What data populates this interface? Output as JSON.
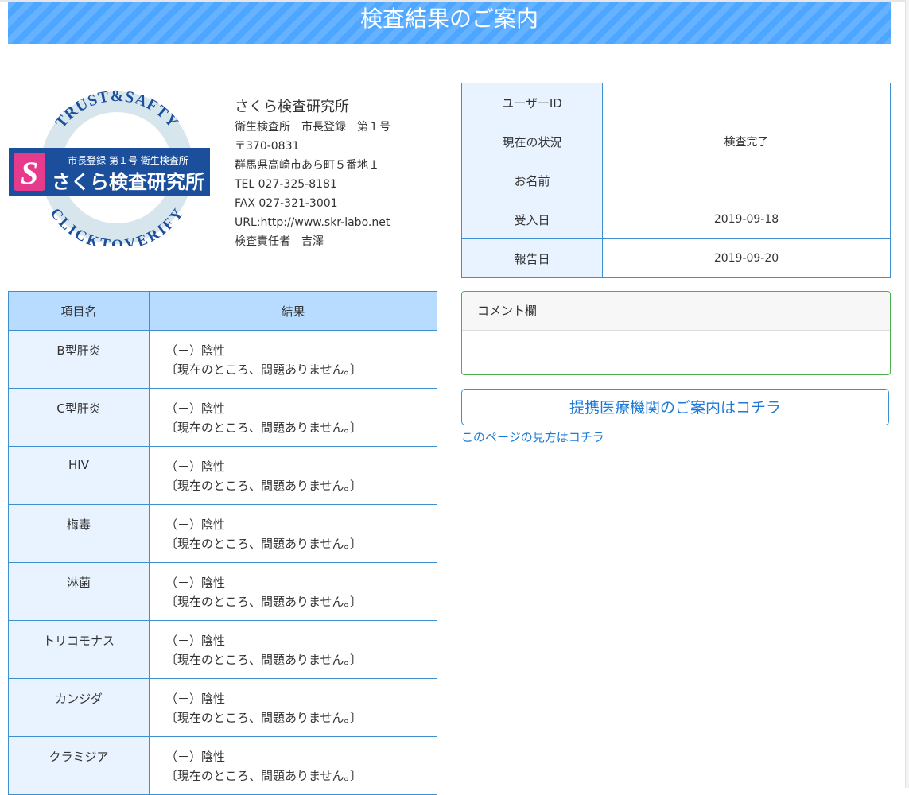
{
  "header": {
    "title": "検査結果のご案内"
  },
  "logo": {
    "ring_top": "TRUST&SAFTY",
    "ring_bottom": "CLICKTOVERIFY",
    "badge_top": "市長登録 第１号 衛生検査所",
    "badge_main": "さくら検査研究所",
    "badge_letter": "S",
    "colors": {
      "navy": "#1b4f9c",
      "ring": "#d6e6ec",
      "pink": "#e63a8c"
    }
  },
  "lab": {
    "name": "さくら検査研究所",
    "lines": [
      "衛生検査所　市長登録　第１号",
      "〒370-0831",
      "群馬県高崎市あら町５番地１",
      "TEL 027-325-8181",
      "FAX 027-321-3001",
      "URL:http://www.skr-labo.net",
      "検査責任者　吉澤"
    ]
  },
  "info": [
    {
      "label": "ユーザーID",
      "value": ""
    },
    {
      "label": "現在の状況",
      "value": "検査完了"
    },
    {
      "label": "お名前",
      "value": ""
    },
    {
      "label": "受入日",
      "value": "2019-09-18"
    },
    {
      "label": "報告日",
      "value": "2019-09-20"
    }
  ],
  "results": {
    "headers": [
      "項目名",
      "結果"
    ],
    "rows": [
      {
        "name": "B型肝炎",
        "line1": "（－）陰性",
        "line2": "〔現在のところ、問題ありません。〕"
      },
      {
        "name": "C型肝炎",
        "line1": "（－）陰性",
        "line2": "〔現在のところ、問題ありません。〕"
      },
      {
        "name": "HIV",
        "line1": "（－）陰性",
        "line2": "〔現在のところ、問題ありません。〕"
      },
      {
        "name": "梅毒",
        "line1": "（－）陰性",
        "line2": "〔現在のところ、問題ありません。〕"
      },
      {
        "name": "淋菌",
        "line1": "（－）陰性",
        "line2": "〔現在のところ、問題ありません。〕"
      },
      {
        "name": "トリコモナス",
        "line1": "（－）陰性",
        "line2": "〔現在のところ、問題ありません。〕"
      },
      {
        "name": "カンジダ",
        "line1": "（－）陰性",
        "line2": "〔現在のところ、問題ありません。〕"
      },
      {
        "name": "クラミジア",
        "line1": "（－）陰性",
        "line2": "〔現在のところ、問題ありません。〕"
      }
    ]
  },
  "comment": {
    "label": "コメント欄",
    "body": ""
  },
  "links": {
    "partner": "提携医療機関のご案内はコチラ",
    "howto": "このページの見方はコチラ"
  },
  "colors": {
    "header_bg": "#4da6ff",
    "table_border": "#3d8fcf",
    "label_bg": "#e8f3ff",
    "result_header_bg": "#b8dcff",
    "comment_border": "#4caf50",
    "link": "#1e7ad6"
  }
}
